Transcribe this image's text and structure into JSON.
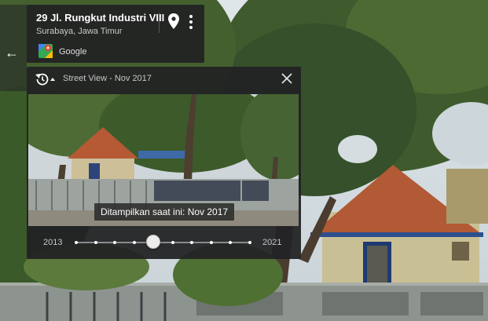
{
  "location": {
    "title": "29 Jl. Rungkut Industri VIII",
    "subtitle": "Surabaya, Jawa Timur",
    "provider": "Google"
  },
  "time_machine": {
    "header_label": "Street View - Nov 2017",
    "caption": "Ditampilkan saat ini: Nov 2017",
    "year_start": "2013",
    "year_end": "2021",
    "tick_count": 10,
    "selected_index": 4
  },
  "icons": {
    "back": "back-arrow-icon",
    "pin": "map-pin-icon",
    "more": "more-vert-icon",
    "maps_logo": "google-maps-icon",
    "history": "history-icon",
    "close": "close-icon"
  }
}
